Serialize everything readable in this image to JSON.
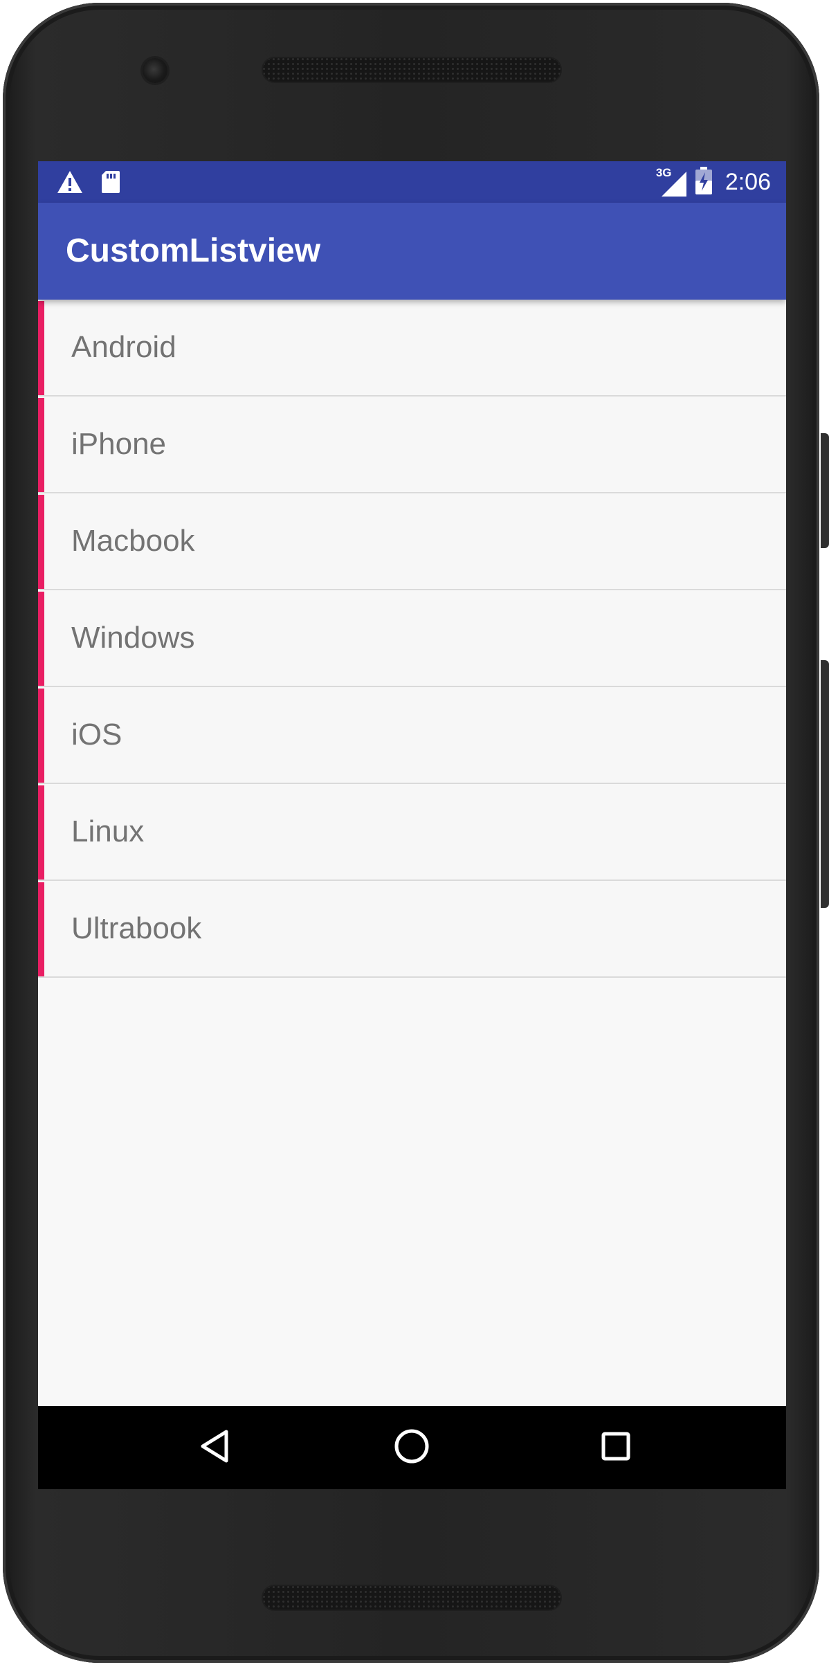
{
  "status_bar": {
    "time": "2:06",
    "network_type": "3G",
    "icons": [
      "warning-icon",
      "sd-card-icon",
      "signal-icon",
      "battery-charging-icon"
    ]
  },
  "app_bar": {
    "title": "CustomListview"
  },
  "list": {
    "items": [
      {
        "label": "Android"
      },
      {
        "label": "iPhone"
      },
      {
        "label": "Macbook"
      },
      {
        "label": "Windows"
      },
      {
        "label": "iOS"
      },
      {
        "label": "Linux"
      },
      {
        "label": "Ultrabook"
      }
    ]
  },
  "nav_bar": {
    "icons": [
      "back-icon",
      "home-icon",
      "recents-icon"
    ]
  },
  "colors": {
    "status_bar": "#303f9f",
    "app_bar": "#3f51b5",
    "accent": "#e91e63",
    "list_background": "#f8f8f8",
    "item_text": "#737373"
  }
}
